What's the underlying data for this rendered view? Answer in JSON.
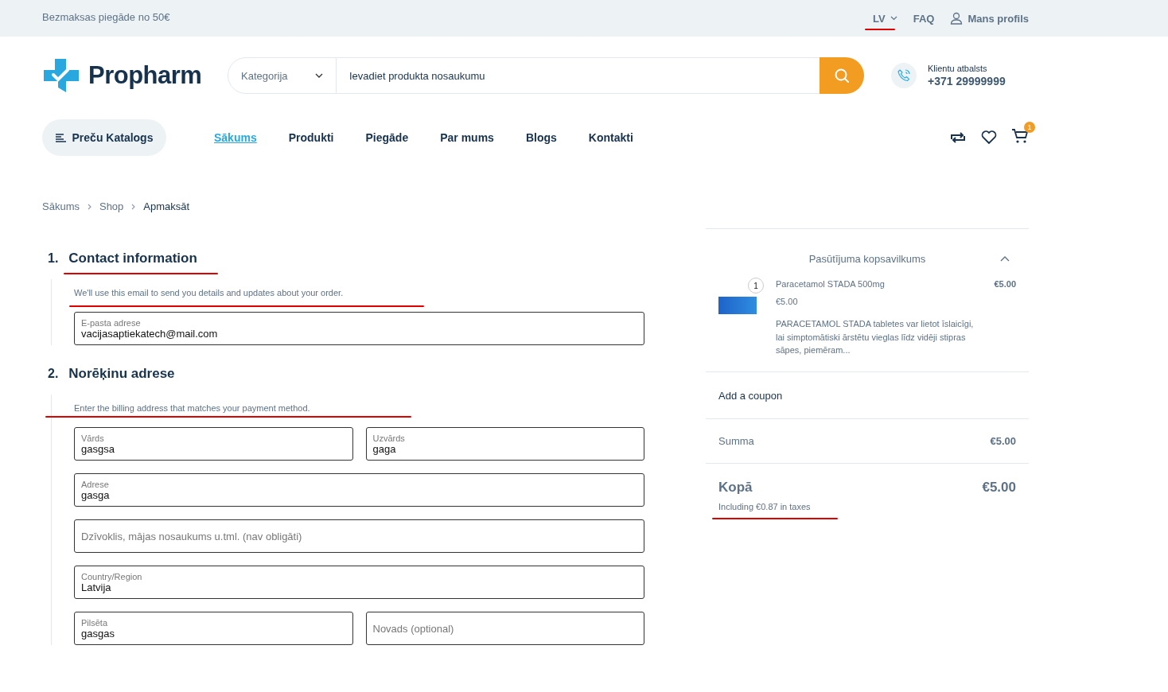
{
  "top_bar": {
    "promo": "Bezmaksas piegāde no 50€",
    "language": "LV",
    "faq": "FAQ",
    "profile": "Mans profils"
  },
  "header": {
    "logo": "Propharm",
    "category": "Kategorija",
    "search_placeholder": "Ievadiet produkta nosaukumu",
    "support_label": "Klientu atbalsts",
    "support_phone": "+371 29999999"
  },
  "nav": {
    "catalog": "Preču Katalogs",
    "items": [
      {
        "label": "Sākums",
        "selected": true
      },
      {
        "label": "Produkti",
        "selected": false
      },
      {
        "label": "Piegāde",
        "selected": false
      },
      {
        "label": "Par mums",
        "selected": false
      },
      {
        "label": "Blogs",
        "selected": false
      },
      {
        "label": "Kontakti",
        "selected": false
      }
    ],
    "cart_count": "1"
  },
  "breadcrumb": [
    "Sākums",
    "Shop",
    "Apmaksāt"
  ],
  "sections": [
    {
      "number": "1.",
      "title": "Contact information",
      "note": "We'll use this email to send you details and updates about your order.",
      "rows": [
        [
          {
            "label": "E-pasta adrese",
            "value": "vacijasaptiekatech@mail.com"
          }
        ]
      ]
    },
    {
      "number": "2.",
      "title": "Norēķinu adrese",
      "note": "Enter the billing address that matches your payment method.",
      "rows": [
        [
          {
            "label": "Vārds",
            "value": "gasgsa"
          },
          {
            "label": "Uzvārds",
            "value": "gaga"
          }
        ],
        [
          {
            "label": "Adrese",
            "value": "gasga"
          }
        ],
        [
          {
            "placeholder": "Dzīvoklis, mājas nosaukums u.tml. (nav obligāti)"
          }
        ],
        [
          {
            "label": "Country/Region",
            "value": "Latvija"
          }
        ],
        [
          {
            "label": "Pilsēta",
            "value": "gasgas"
          },
          {
            "placeholder": "Novads (optional)"
          }
        ]
      ]
    }
  ],
  "summary": {
    "title": "Pasūtījuma kopsavilkums",
    "expanded": true,
    "item": {
      "quantity": "1",
      "name": "Paracetamol STADA 500mg",
      "unit_price": "€5.00",
      "description": "PARACETAMOL STADA tabletes var lietot īslaicīgi, lai simptomātiski ārstētu vieglas līdz vidēji stipras sāpes, piemēram...",
      "price": "€5.00"
    },
    "coupon": "Add a coupon",
    "subtotal_label": "Summa",
    "subtotal": "€5.00",
    "total_label": "Kopā",
    "total": "€5.00",
    "tax_note": "Including €0.87 in taxes"
  }
}
